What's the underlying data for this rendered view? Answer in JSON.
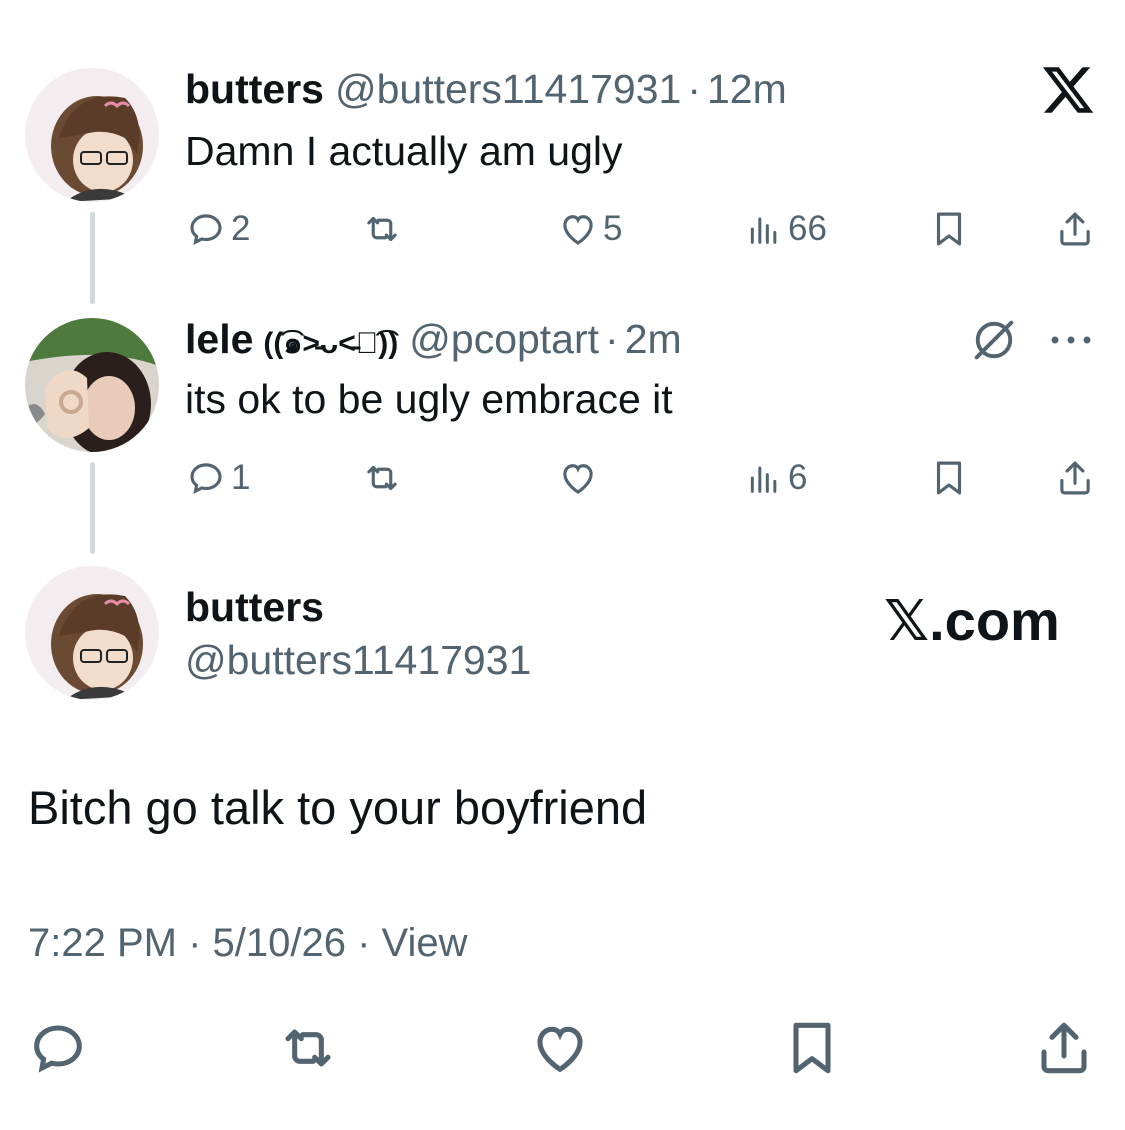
{
  "tweets": [
    {
      "name": "butters",
      "handle": "@butters11417931",
      "time": "12m",
      "text": "Damn I actually am ugly",
      "replies": "2",
      "retweets": "",
      "likes": "5",
      "views": "66"
    },
    {
      "name": "lele",
      "emoticon": "((͡๑˃̵ᴗ˂̵๑͡))",
      "handle": "@pcoptart",
      "time": "2m",
      "text": "its ok to be ugly embrace it",
      "replies": "1",
      "retweets": "",
      "likes": "",
      "views": "6"
    }
  ],
  "main": {
    "name": "butters",
    "handle": "@butters11417931",
    "text": "Bitch go talk to your boyfriend",
    "timestamp": "7:22 PM · 5/10/26 · View"
  },
  "brand": {
    "logo_text": "𝕏.com",
    "x_icon": "x-logo-icon"
  },
  "separator": "·",
  "colors": {
    "text": "#0f1419",
    "muted": "#536471",
    "line": "#cfd9de"
  }
}
